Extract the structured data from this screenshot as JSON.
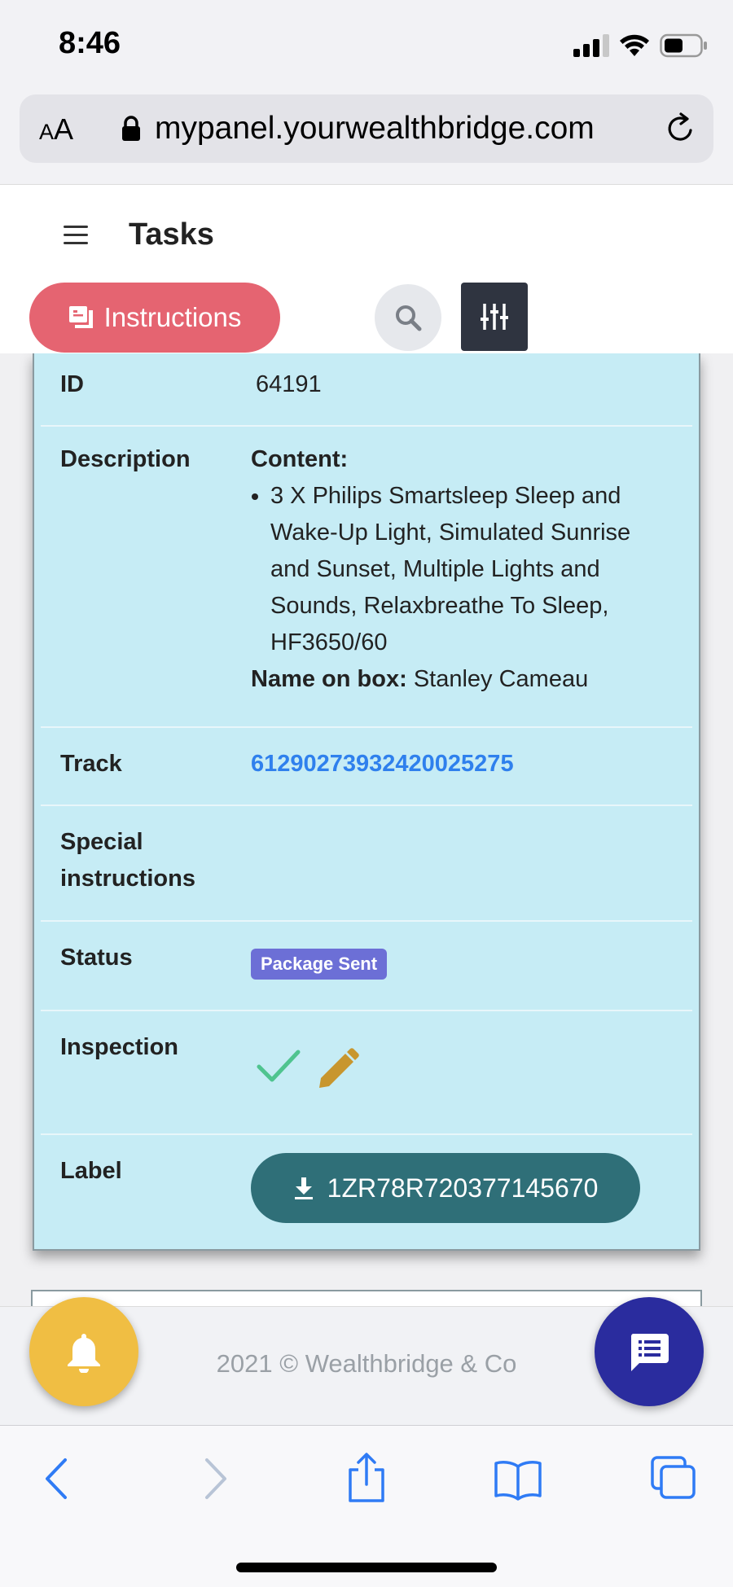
{
  "status_bar": {
    "time": "8:46"
  },
  "browser": {
    "text_size_label_small": "A",
    "text_size_label_large": "A",
    "url": "mypanel.yourwealthbridge.com"
  },
  "header": {
    "title": "Tasks",
    "instructions_label": "Instructions"
  },
  "task": {
    "id_label": "ID",
    "id_value": "64191",
    "description_label": "Description",
    "content_heading": "Content:",
    "content_items": [
      "3 X Philips Smartsleep Sleep and Wake-Up Light, Simulated Sunrise and Sunset, Multiple Lights and Sounds, Relaxbreathe To Sleep, HF3650/60"
    ],
    "name_on_box_label": "Name on box:",
    "name_on_box_value": "Stanley Cameau",
    "track_label": "Track",
    "track_value": "61290273932420025275",
    "special_label_line1": "Special",
    "special_label_line2": "instructions",
    "special_value": "",
    "status_label": "Status",
    "status_value": "Package Sent",
    "inspection_label": "Inspection",
    "label_label": "Label",
    "label_code": "1ZR78R720377145670"
  },
  "footer": {
    "copyright": "2021 © Wealthbridge & Co"
  },
  "colors": {
    "card_bg": "#c6ecf5",
    "instructions_btn": "#e56471",
    "badge": "#6c6fd6",
    "label_btn": "#2f6f78",
    "bell": "#f0be43",
    "chat": "#2a2c9e",
    "link": "#2f80ed"
  },
  "icons": [
    "signal-icon",
    "wifi-icon",
    "battery-icon",
    "lock-icon",
    "reload-icon",
    "hamburger-icon",
    "instructions-icon",
    "search-icon",
    "filter-icon",
    "check-icon",
    "pencil-icon",
    "download-icon",
    "bell-icon",
    "chat-icon",
    "back-icon",
    "forward-icon",
    "share-icon",
    "bookmarks-icon",
    "tabs-icon"
  ]
}
